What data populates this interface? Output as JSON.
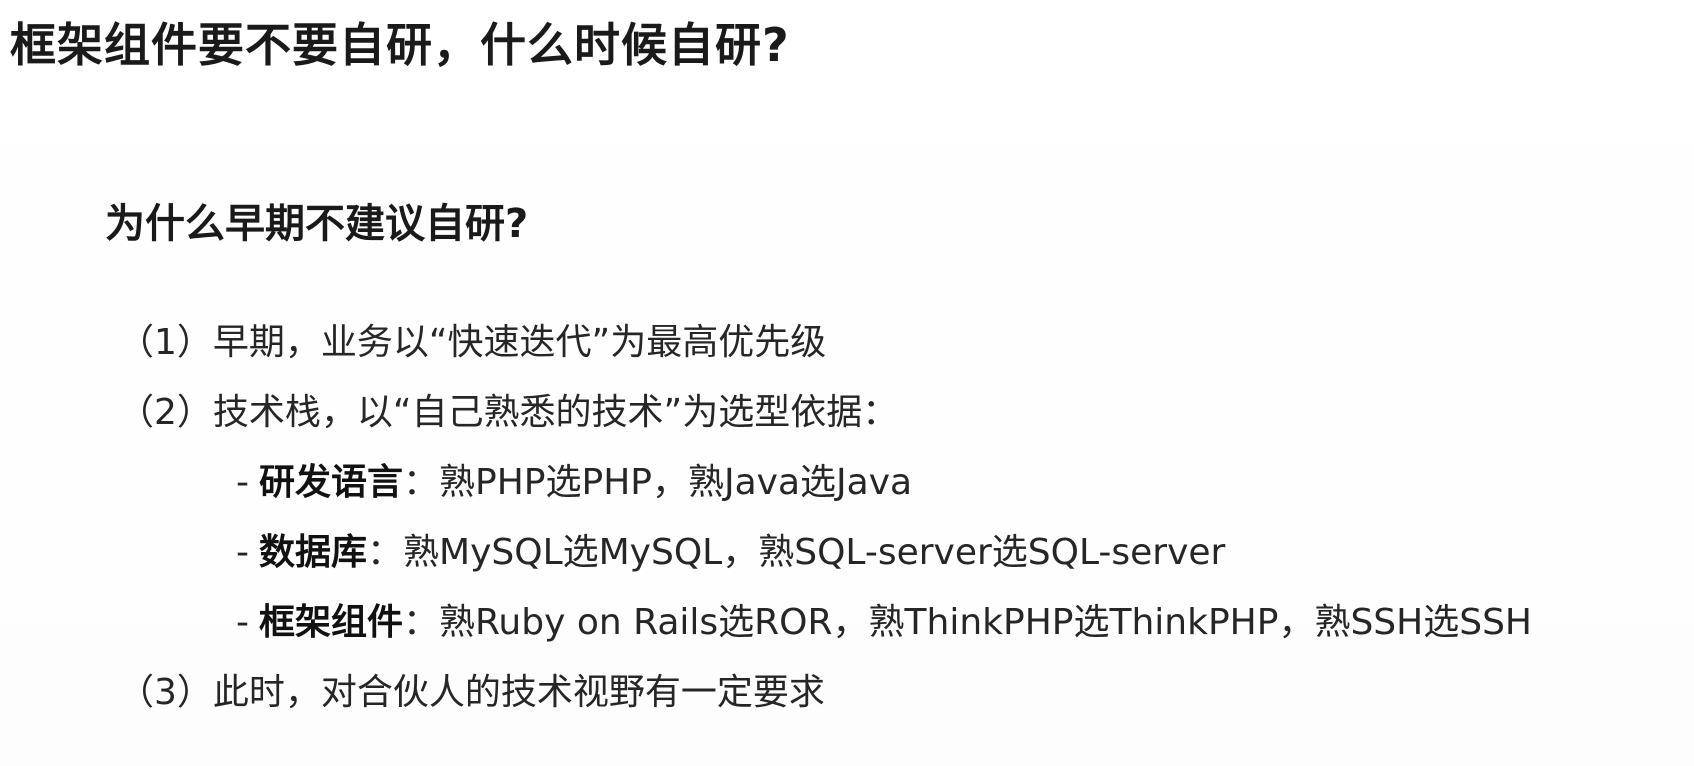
{
  "title": "框架组件要不要自研，什么时候自研?",
  "subtitle": "为什么早期不建议自研?",
  "points": [
    {
      "text": "（1）早期，业务以“快速迭代”为最高优先级"
    },
    {
      "text": "（2）技术栈，以“自己熟悉的技术”为选型依据："
    }
  ],
  "sub_points": [
    {
      "dash": "-",
      "key": "研发语言",
      "value": "：熟PHP选PHP，熟Java选Java"
    },
    {
      "dash": "-",
      "key": "数据库",
      "value": "：熟MySQL选MySQL，熟SQL-server选SQL-server"
    },
    {
      "dash": "-",
      "key": "框架组件",
      "value": "：熟Ruby on Rails选ROR，熟ThinkPHP选ThinkPHP，熟SSH选SSH"
    }
  ],
  "last_point": {
    "text": "（3）此时，对合伙人的技术视野有一定要求"
  }
}
